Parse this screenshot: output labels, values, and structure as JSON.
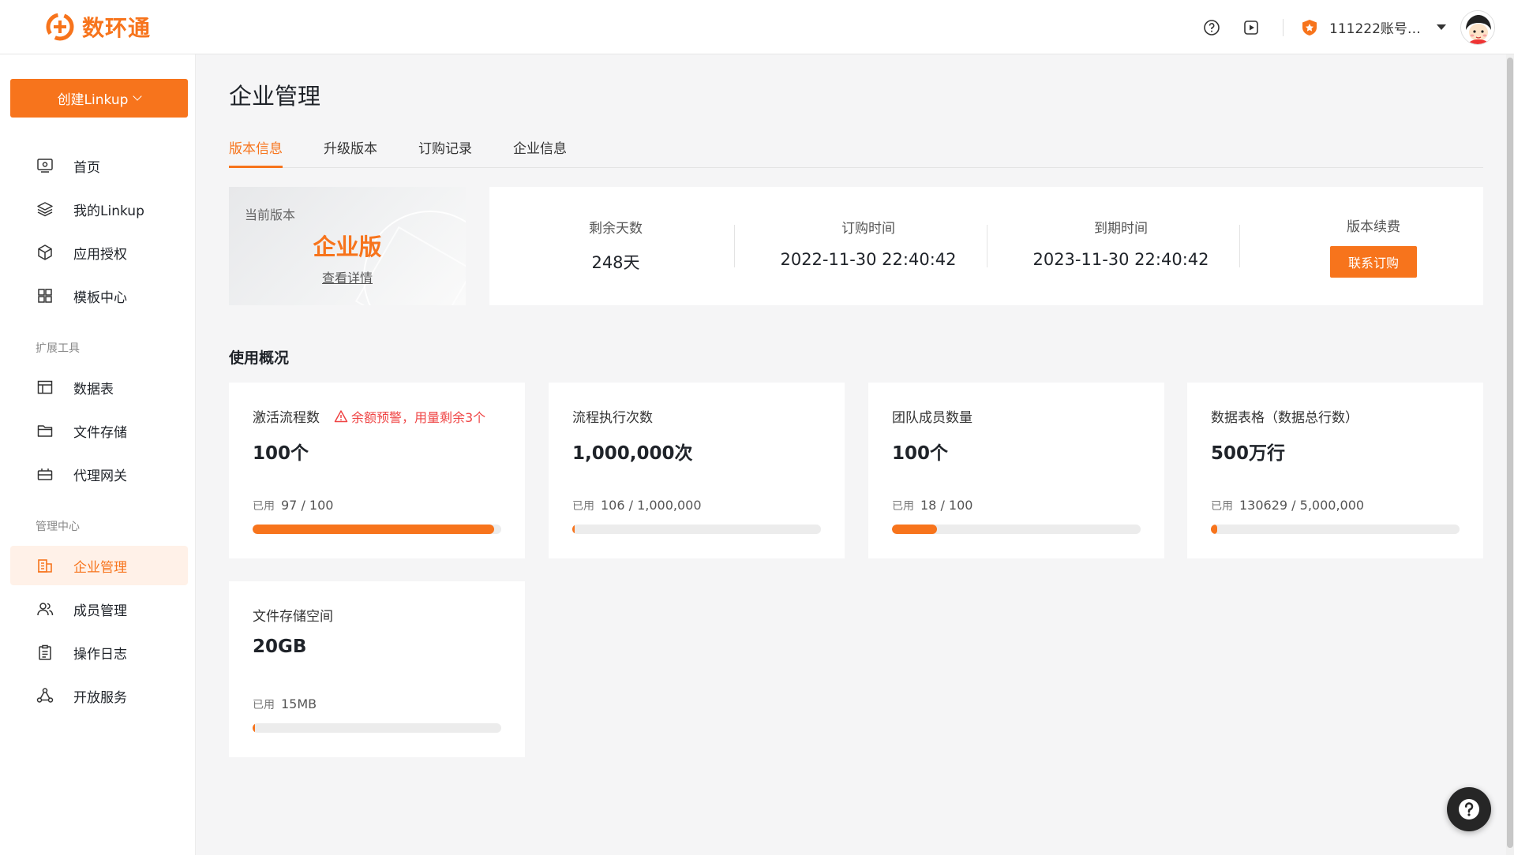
{
  "app": {
    "name": "数环通",
    "brand_color": "#f7741c"
  },
  "header": {
    "icons": [
      "help-circle-icon",
      "play-video-icon",
      "account-badge-icon"
    ],
    "account_name": "111222账号…",
    "avatar": "user-avatar"
  },
  "sidebar": {
    "create_button": "创建Linkup",
    "main_items": [
      {
        "label": "首页",
        "icon": "monitor-icon"
      },
      {
        "label": "我的Linkup",
        "icon": "layers-icon"
      },
      {
        "label": "应用授权",
        "icon": "cube-icon"
      },
      {
        "label": "模板中心",
        "icon": "grid-icon"
      }
    ],
    "section_tools": "扩展工具",
    "tool_items": [
      {
        "label": "数据表",
        "icon": "table-icon"
      },
      {
        "label": "文件存储",
        "icon": "folder-icon"
      },
      {
        "label": "代理网关",
        "icon": "gateway-icon"
      }
    ],
    "section_admin": "管理中心",
    "admin_items": [
      {
        "label": "企业管理",
        "icon": "building-icon",
        "active": true
      },
      {
        "label": "成员管理",
        "icon": "users-icon"
      },
      {
        "label": "操作日志",
        "icon": "clipboard-icon"
      },
      {
        "label": "开放服务",
        "icon": "share-nodes-icon"
      }
    ]
  },
  "main": {
    "title": "企业管理",
    "tabs": [
      {
        "label": "版本信息",
        "active": true
      },
      {
        "label": "升级版本"
      },
      {
        "label": "订购记录"
      },
      {
        "label": "企业信息"
      }
    ],
    "version": {
      "label": "当前版本",
      "name": "企业版",
      "link": "查看详情"
    },
    "stats": {
      "remaining_label": "剩余天数",
      "remaining_value": "248天",
      "order_label": "订购时间",
      "order_value": "2022-11-30 22:40:42",
      "expire_label": "到期时间",
      "expire_value": "2023-11-30 22:40:42",
      "renew_label": "版本续费",
      "renew_button": "联系订购"
    },
    "usage_title": "使用概况",
    "used_prefix": "已用",
    "usage": [
      {
        "label": "激活流程数",
        "warning": "余额预警，用量剩余3个",
        "value": "100个",
        "used": "97 / 100",
        "ratio": 0.97
      },
      {
        "label": "流程执行次数",
        "value": "1,000,000次",
        "used": "106 / 1,000,000",
        "ratio": 0.000106
      },
      {
        "label": "团队成员数量",
        "value": "100个",
        "used": "18 / 100",
        "ratio": 0.18
      },
      {
        "label": "数据表格（数据总行数）",
        "value": "500万行",
        "used": "130629 / 5,000,000",
        "ratio": 0.026
      },
      {
        "label": "文件存储空间",
        "value": "20GB",
        "used": "15MB",
        "ratio": 0.0007
      }
    ]
  }
}
